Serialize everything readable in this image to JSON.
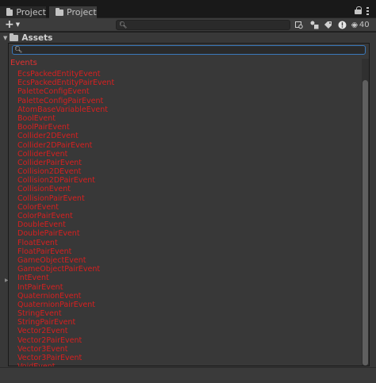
{
  "tabs": [
    {
      "label": "Project",
      "active": false
    },
    {
      "label": "Project",
      "active": true
    }
  ],
  "toolbar": {
    "create_label": "+",
    "search_placeholder": "",
    "hidden_count": "40"
  },
  "tree": {
    "root_label": "Assets"
  },
  "popup": {
    "search_value": "",
    "group_label": "Events",
    "items": [
      "EcsPackedEntityEvent",
      "EcsPackedEntityPairEvent",
      "PaletteConfigEvent",
      "PaletteConfigPairEvent",
      "AtomBaseVariableEvent",
      "BoolEvent",
      "BoolPairEvent",
      "Collider2DEvent",
      "Collider2DPairEvent",
      "ColliderEvent",
      "ColliderPairEvent",
      "Collision2DEvent",
      "Collision2DPairEvent",
      "CollisionEvent",
      "CollisionPairEvent",
      "ColorEvent",
      "ColorPairEvent",
      "DoubleEvent",
      "DoublePairEvent",
      "FloatEvent",
      "FloatPairEvent",
      "GameObjectEvent",
      "GameObjectPairEvent",
      "IntEvent",
      "IntPairEvent",
      "QuaternionEvent",
      "QuaternionPairEvent",
      "StringEvent",
      "StringPairEvent",
      "Vector2Event",
      "Vector2PairEvent",
      "Vector3Event",
      "Vector3PairEvent",
      "VoidEvent"
    ]
  },
  "colors": {
    "item_text": "#d82020",
    "panel_bg": "#383838",
    "search_focus": "#3a79bb"
  }
}
